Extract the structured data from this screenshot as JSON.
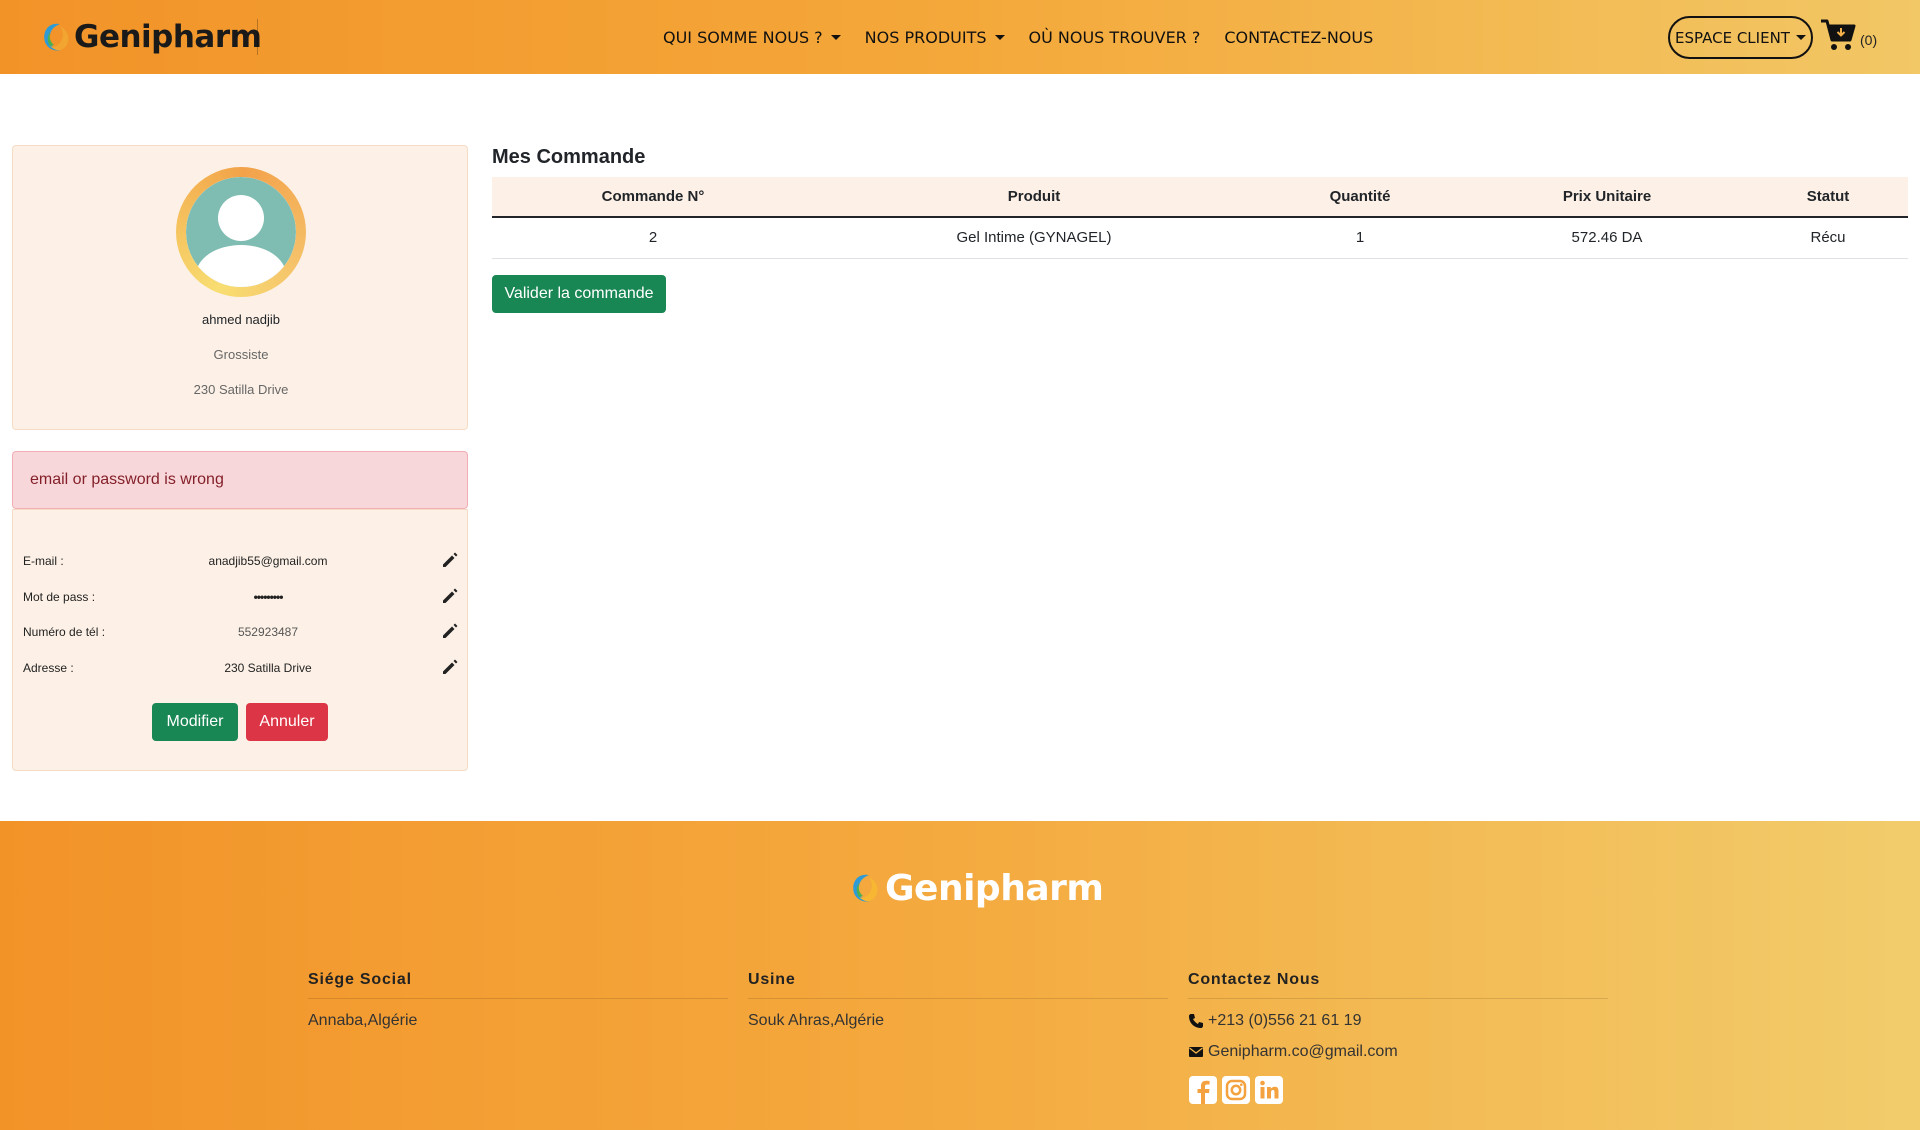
{
  "brand": {
    "name": "Genipharm"
  },
  "nav": {
    "items": [
      {
        "label": "QUI SOMME NOUS ?",
        "dropdown": true
      },
      {
        "label": "NOS PRODUITS",
        "dropdown": true
      },
      {
        "label": "OÙ NOUS TROUVER ?",
        "dropdown": false
      },
      {
        "label": "CONTACTEZ-NOUS",
        "dropdown": false
      }
    ],
    "espace_client": "ESPACE CLIENT",
    "cart_count": "(0)"
  },
  "profile": {
    "name": "ahmed nadjib",
    "role": "Grossiste",
    "address": "230 Satilla Drive"
  },
  "alert": {
    "message": "email or password is wrong"
  },
  "account": {
    "email_label": "E-mail :",
    "email_value": "anadjib55@gmail.com",
    "password_label": "Mot de pass :",
    "password_value": "•••••••••",
    "phone_label": "Numéro de tél :",
    "phone_value": "552923487",
    "address_label": "Adresse :",
    "address_value": "230 Satilla Drive",
    "modifier_label": "Modifier",
    "annuler_label": "Annuler"
  },
  "orders": {
    "title": "Mes Commande",
    "columns": [
      "Commande N°",
      "Produit",
      "Quantité",
      "Prix Unitaire",
      "Statut"
    ],
    "rows": [
      [
        "2",
        "Gel Intime (GYNAGEL)",
        "1",
        "572.46 DA",
        "Récu"
      ]
    ],
    "validate_label": "Valider la commande"
  },
  "footer": {
    "brand": "Genipharm",
    "siege": {
      "title": "Siége Social",
      "text": "Annaba,Algérie"
    },
    "usine": {
      "title": "Usine",
      "text": "Souk Ahras,Algérie"
    },
    "contact": {
      "title": "Contactez Nous",
      "phone": "+213 (0)556 21 61 19",
      "email": "Genipharm.co@gmail.com"
    },
    "socials": [
      "facebook-icon",
      "instagram-icon",
      "linkedin-icon"
    ]
  },
  "colors": {
    "accent_orange": "#f29328",
    "accent_yellow": "#f2c765",
    "success": "#198754",
    "danger": "#dc3545",
    "card_bg": "#fdf1e7",
    "alert_bg": "#f8d7da"
  }
}
